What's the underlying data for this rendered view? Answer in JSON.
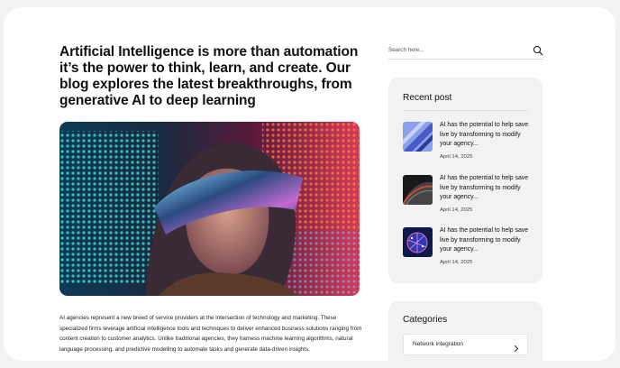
{
  "article": {
    "headline": "Artificial Intelligence is more than automation it’s the power to think, learn, and create. Our blog explores the latest breakthroughs, from generative AI to deep learning",
    "hero_image_alt": "Woman wearing reflective visor glasses in front of neon LED lights",
    "body": "AI agencies represent a new breed of service providers at the  intersection of technology and marketing. These specialized firms  leverage artificial intelligence tools and techniques to deliver  enhanced business solutions ranging from content creation to customer  analytics. Unlike traditional agencies, they harness machine learning algorithms, natural language processing, and predictive modelling to  automate tasks and generate data-driven insights."
  },
  "search": {
    "placeholder": "Search here..."
  },
  "sidebar": {
    "recent": {
      "title": "Recent post",
      "posts": [
        {
          "title": "AI has the potential to help save live by transforming to modify your agency...",
          "date": "April 14, 2025"
        },
        {
          "title": "AI has the potential to help save live by transforming to modify your agency...",
          "date": "April 14, 2025"
        },
        {
          "title": "AI has the potential to help save live by transforming to modify your agency...",
          "date": "April 14, 2025"
        }
      ]
    },
    "categories": {
      "title": "Categories",
      "items": [
        {
          "label": "Network integration"
        }
      ]
    }
  },
  "colors": {
    "page_bg": "#f2f2f2",
    "card_bg": "#f2f2f2",
    "surface": "#ffffff",
    "text": "#111111"
  }
}
